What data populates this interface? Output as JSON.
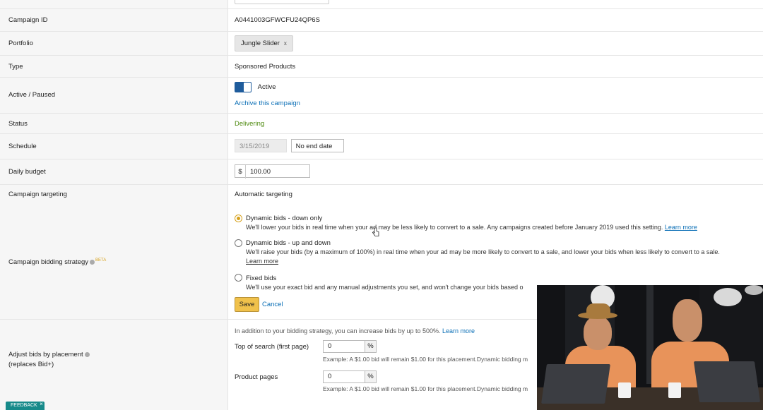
{
  "fields": {
    "campaign_id": {
      "label": "Campaign ID",
      "value": "A0441003GFWCFU24QP6S"
    },
    "portfolio": {
      "label": "Portfolio",
      "value": "Jungle Slider",
      "remove": "x"
    },
    "type": {
      "label": "Type",
      "value": "Sponsored Products"
    },
    "active": {
      "label": "Active / Paused",
      "toggle_label": "Active",
      "archive_link": "Archive this campaign"
    },
    "status": {
      "label": "Status",
      "value": "Delivering",
      "color": "#4f8a10"
    },
    "schedule": {
      "label": "Schedule",
      "start_date": "3/15/2019",
      "end_date": "No end date"
    },
    "daily_budget": {
      "label": "Daily budget",
      "currency": "$",
      "value": "100.00"
    },
    "targeting": {
      "label": "Campaign targeting",
      "value": "Automatic targeting"
    }
  },
  "bidding": {
    "label": "Campaign bidding strategy",
    "badge": "BETA",
    "options": [
      {
        "title": "Dynamic bids - down only",
        "selected": true,
        "desc": "We'll lower your bids in real time when your ad may be less likely to convert to a sale. Any campaigns created before January 2019 used this setting.",
        "link": "Learn more"
      },
      {
        "title": "Dynamic bids - up and down",
        "selected": false,
        "desc": "We'll raise your bids (by a maximum of 100%) in real time when your ad may be more likely to convert to a sale, and lower your bids when less likely to convert to a sale.",
        "link": "Learn more"
      },
      {
        "title": "Fixed bids",
        "selected": false,
        "desc": "We'll use your exact bid and any manual adjustments you set, and won't change your bids based o"
      }
    ],
    "save_label": "Save",
    "cancel_label": "Cancel"
  },
  "placement": {
    "label": "Adjust bids by placement",
    "sublabel": "(replaces Bid+)",
    "intro": "In addition to your bidding strategy, you can increase bids by up to 500%.",
    "intro_link": "Learn more",
    "rows": [
      {
        "name": "Top of search (first page)",
        "value": "0",
        "unit": "%",
        "example": "Example: A $1.00 bid will remain $1.00 for this placement.Dynamic bidding m"
      },
      {
        "name": "Product pages",
        "value": "0",
        "unit": "%",
        "example": "Example: A $1.00 bid will remain $1.00 for this placement.Dynamic bidding m"
      }
    ]
  },
  "feedback": {
    "label": "FEEDBACK",
    "close": "×"
  },
  "colors": {
    "accent": "#f0c14b",
    "link": "#0b6fb6",
    "toggle": "#1f5c9c",
    "radio": "#d7a21d",
    "feedback": "#178a8a"
  }
}
